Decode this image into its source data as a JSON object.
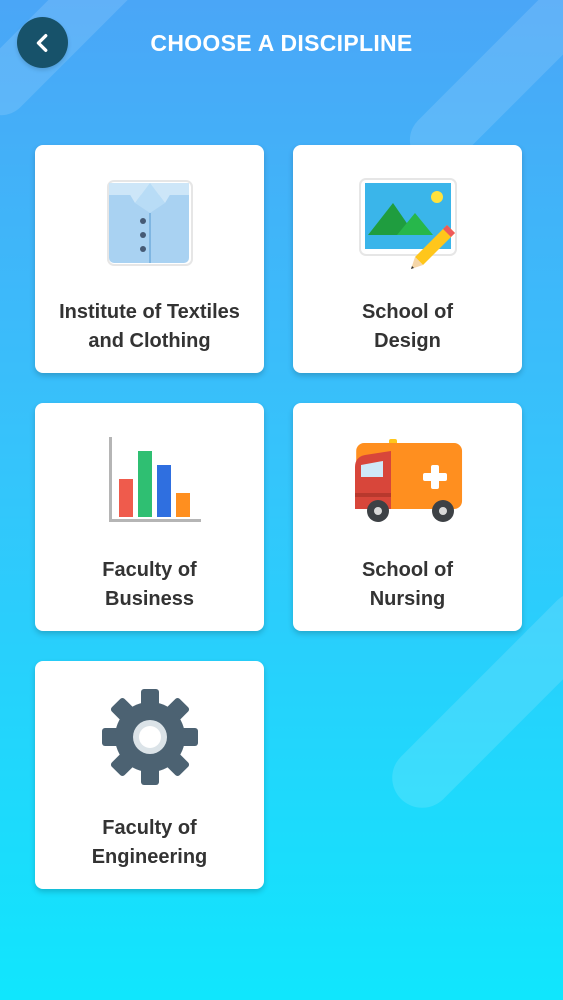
{
  "header": {
    "title": "CHOOSE A DISCIPLINE",
    "back_icon": "chevron-left-icon"
  },
  "disciplines": [
    {
      "label": "Institute of Textiles\nand Clothing",
      "icon": "shirt-icon"
    },
    {
      "label": "School of\nDesign",
      "icon": "image-pencil-icon"
    },
    {
      "label": "Faculty of\nBusiness",
      "icon": "bar-chart-icon"
    },
    {
      "label": "School of\nNursing",
      "icon": "ambulance-icon"
    },
    {
      "label": "Faculty of\nEngineering",
      "icon": "gear-icon"
    }
  ],
  "colors": {
    "background_top": "#4aa6f7",
    "background_bottom": "#10e6fd",
    "back_button": "#17526a",
    "card": "#ffffff",
    "label_text": "#333333"
  }
}
